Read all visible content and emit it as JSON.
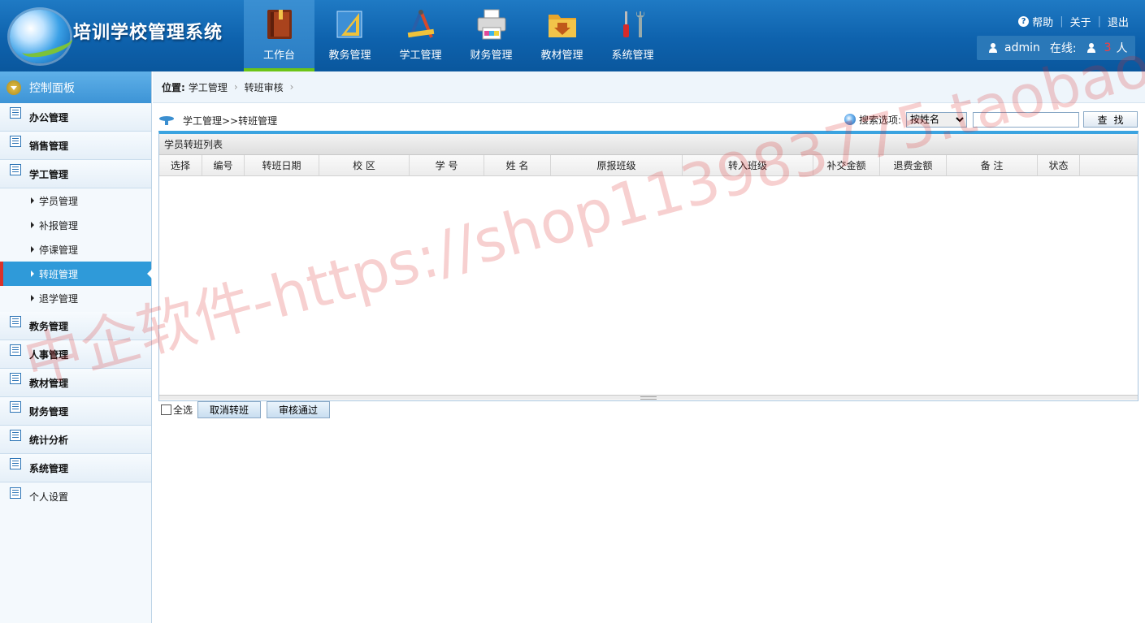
{
  "app": {
    "title": "培训学校管理系统"
  },
  "topnav": {
    "items": [
      {
        "label": "工作台",
        "icon": "book-icon",
        "active": true
      },
      {
        "label": "教务管理",
        "icon": "ruler-icon"
      },
      {
        "label": "学工管理",
        "icon": "compass-icon"
      },
      {
        "label": "财务管理",
        "icon": "printer-icon"
      },
      {
        "label": "教材管理",
        "icon": "download-folder-icon"
      },
      {
        "label": "系统管理",
        "icon": "tools-icon"
      }
    ]
  },
  "toplinks": {
    "help": "帮助",
    "about": "关于",
    "logout": "退出"
  },
  "userbar": {
    "username": "admin",
    "online_label": "在线:",
    "online_count": "3",
    "online_unit": "人"
  },
  "sidebar": {
    "header": "控制面板",
    "sections_top": [
      "办公管理",
      "销售管理",
      "学工管理"
    ],
    "subitems": [
      "学员管理",
      "补报管理",
      "停课管理",
      "转班管理",
      "退学管理"
    ],
    "active_subitem": "转班管理",
    "sections_bottom": [
      "教务管理",
      "人事管理",
      "教材管理",
      "财务管理",
      "统计分析",
      "系统管理"
    ],
    "personal": "个人设置"
  },
  "breadcrumb": {
    "label": "位置:",
    "items": [
      "学工管理",
      "转班审核"
    ]
  },
  "page": {
    "title": "学工管理>>转班管理"
  },
  "search": {
    "label": "搜索选项:",
    "selected_option": "按姓名",
    "input_value": "",
    "button": "查找"
  },
  "grid": {
    "title": "学员转班列表",
    "columns": [
      "选择",
      "编号",
      "转班日期",
      "校 区",
      "学 号",
      "姓 名",
      "原报班级",
      "转入班级",
      "补交金额",
      "退费金额",
      "备 注",
      "状态"
    ],
    "rows": []
  },
  "actions": {
    "select_all": "全选",
    "cancel": "取消转班",
    "approve": "审核通过"
  },
  "watermark": "中企软件-https://shop113983775.taobao.com",
  "colors": {
    "header_blue": "#0e62ad",
    "active_green": "#6cc417",
    "accent_blue": "#3aa3e0",
    "online_red": "#ff3b3b"
  }
}
